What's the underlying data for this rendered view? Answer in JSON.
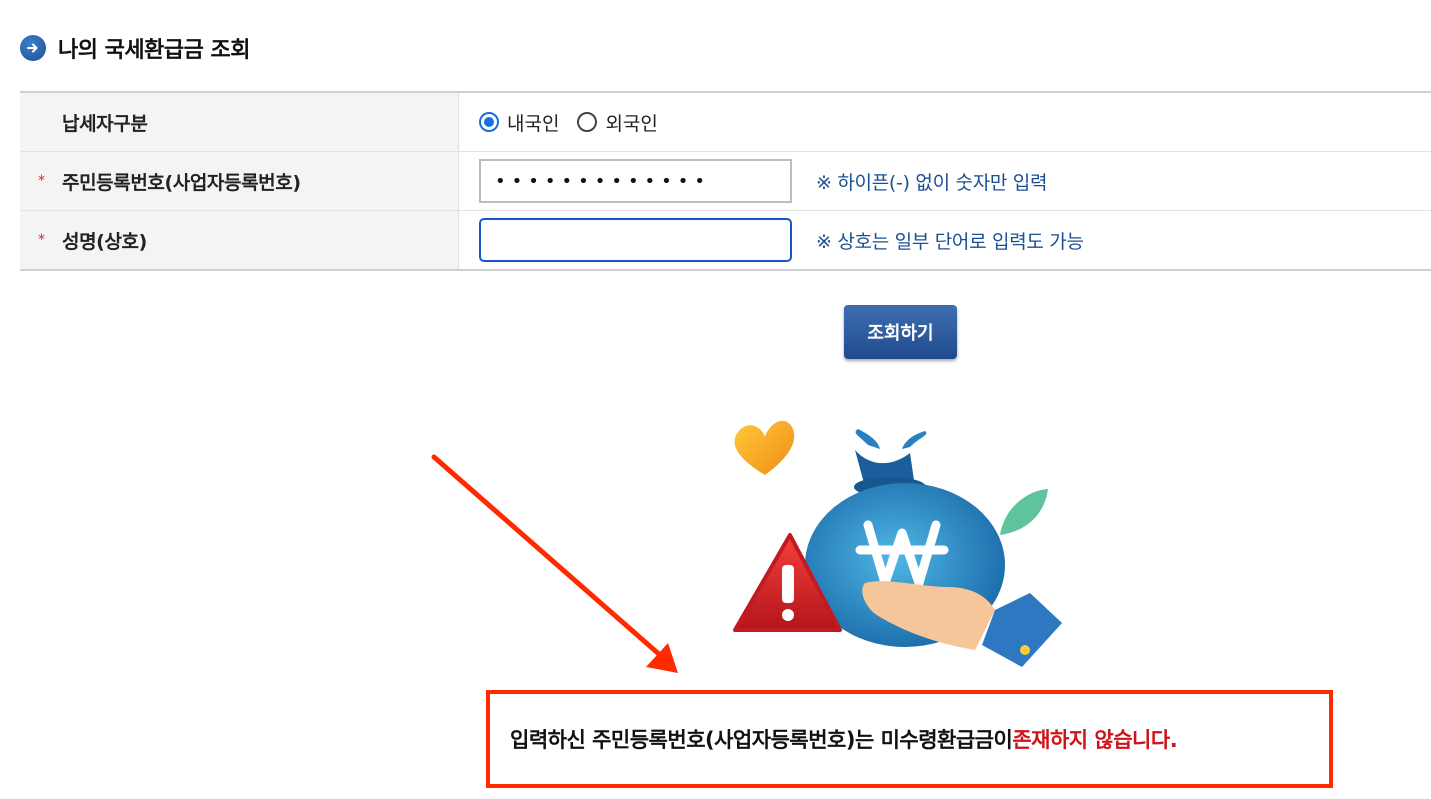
{
  "page_title": "나의 국세환급금 조회",
  "form": {
    "taxpayer_type": {
      "label": "납세자구분",
      "options": [
        {
          "label": "내국인",
          "checked": true
        },
        {
          "label": "외국인",
          "checked": false
        }
      ]
    },
    "id_number": {
      "required_mark": "*",
      "label": "주민등록번호(사업자등록번호)",
      "value": "•••••••••••••",
      "hint": "※ 하이픈(-) 없이 숫자만 입력"
    },
    "name": {
      "required_mark": "*",
      "label": "성명(상호)",
      "value": "",
      "hint": "※ 상호는 일부 단어로 입력도 가능"
    }
  },
  "search_button_label": "조회하기",
  "result": {
    "message": "입력하신 주민등록번호(사업자등록번호)는 미수령환급금이 ",
    "emphasis": "존재하지 않습니다."
  },
  "icons": {
    "title": "arrow-circle-icon",
    "illustration": "money-bag-warning-illustration",
    "annotation": "red-arrow"
  },
  "colors": {
    "accent_blue": "#1b4f93",
    "required_red": "#d9262a",
    "highlight_red": "#ff2a00",
    "emphasis_red": "#d0121a"
  }
}
